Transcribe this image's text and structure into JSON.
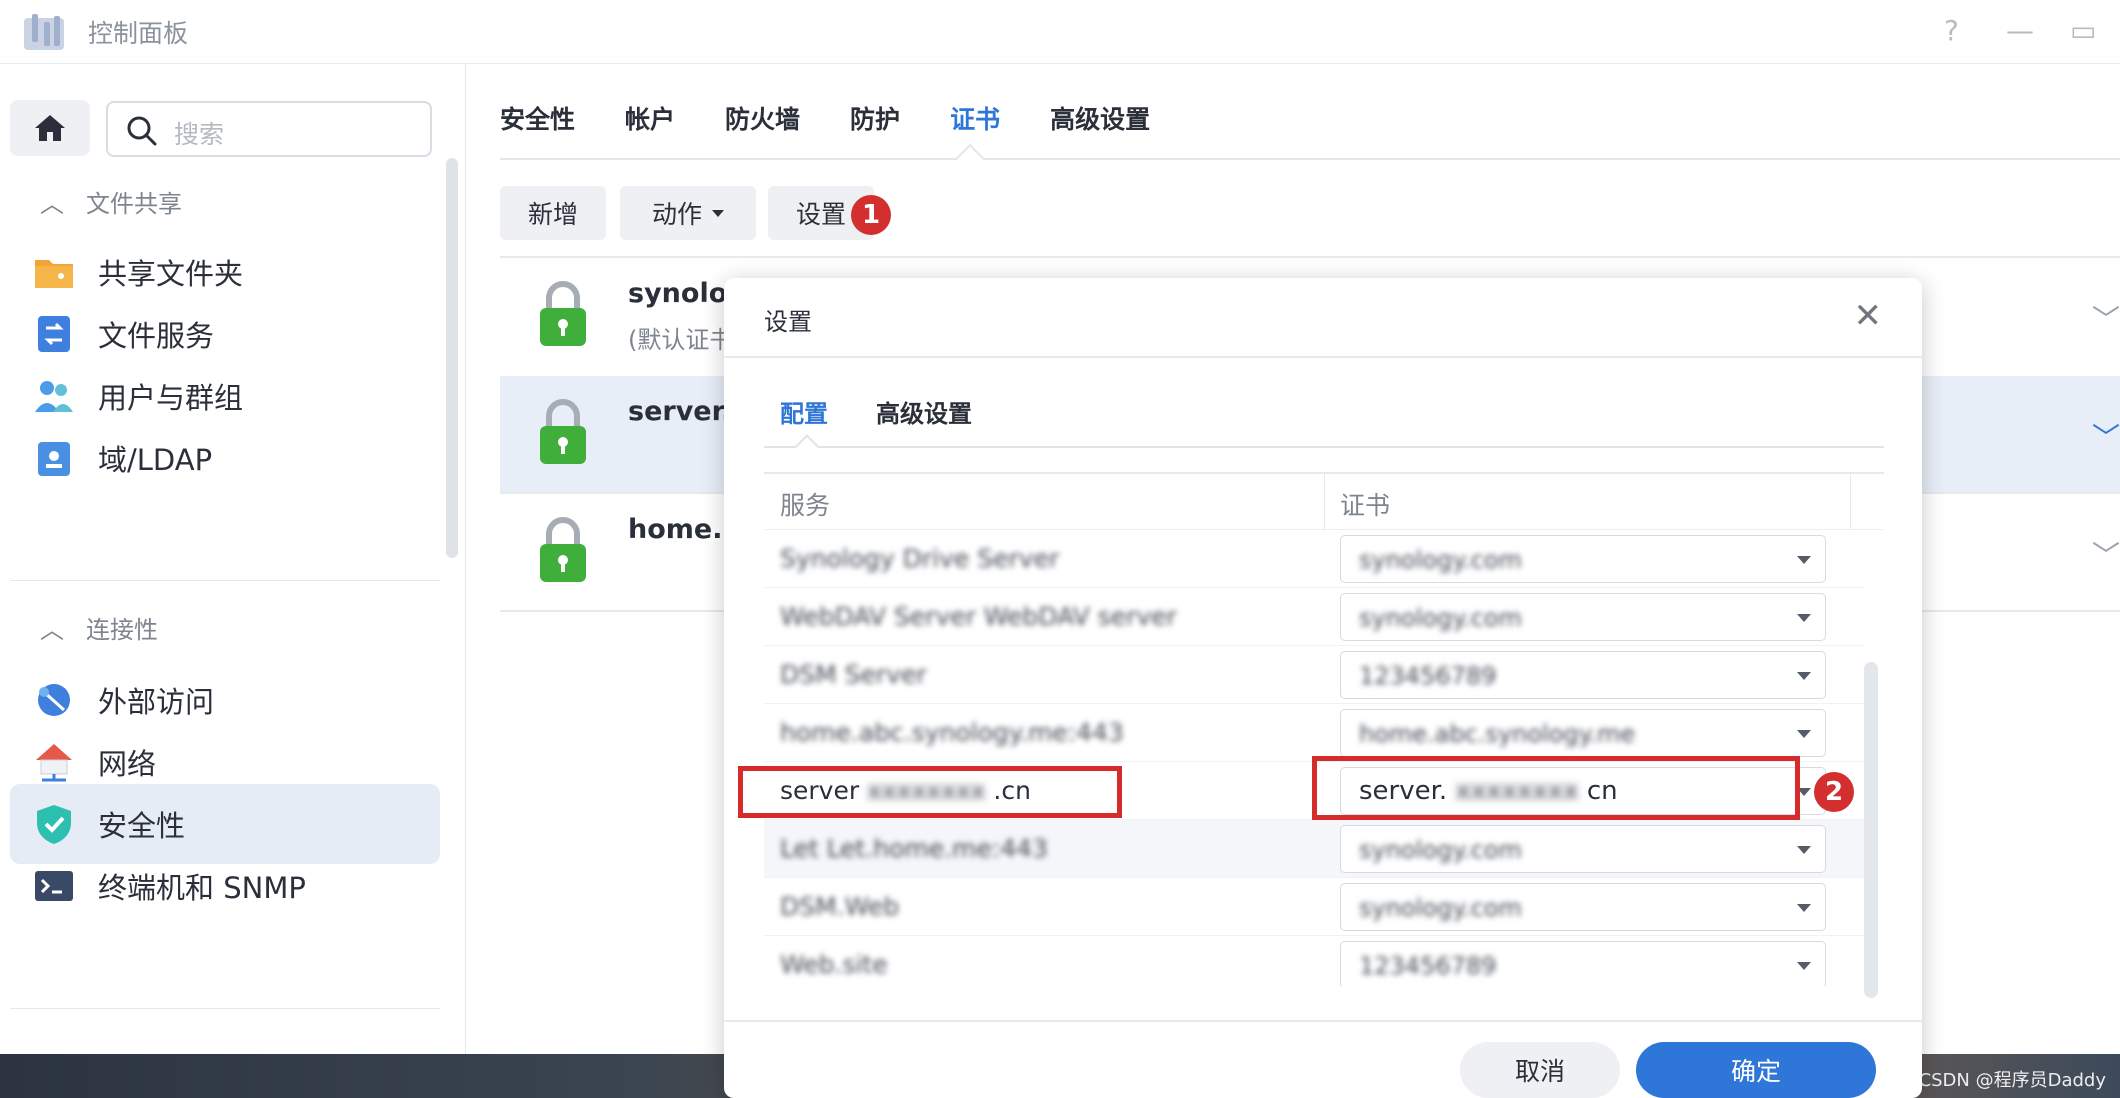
{
  "window": {
    "title": "控制面板",
    "help": "?",
    "minimize": "—",
    "maximize": "▭"
  },
  "sidebar": {
    "search_placeholder": "搜索",
    "section_file_sharing": "文件共享",
    "section_connectivity": "连接性",
    "items": [
      {
        "label": "共享文件夹"
      },
      {
        "label": "文件服务"
      },
      {
        "label": "用户与群组"
      },
      {
        "label": "域/LDAP"
      },
      {
        "label": "外部访问"
      },
      {
        "label": "网络"
      },
      {
        "label": "安全性"
      },
      {
        "label": "终端机和 SNMP"
      }
    ]
  },
  "main": {
    "tabs": [
      "安全性",
      "帐户",
      "防火墙",
      "防护",
      "证书",
      "高级设置"
    ],
    "active_tab": "证书",
    "toolbar": {
      "add": "新增",
      "action": "动作",
      "settings": "设置"
    },
    "certificates": [
      {
        "name": "synolo",
        "sub": "(默认证书"
      },
      {
        "name": "server.",
        "sub": ""
      },
      {
        "name": "home.l",
        "sub": ""
      }
    ]
  },
  "dialog": {
    "title": "设置",
    "close": "✕",
    "tabs": [
      "配置",
      "高级设置"
    ],
    "active_tab": "配置",
    "columns": {
      "service": "服务",
      "certificate": "证书"
    },
    "rows": [
      {
        "service": "Synology Drive Server",
        "cert": "synology.com"
      },
      {
        "service": "WebDAV Server WebDAV server",
        "cert": "synology.com"
      },
      {
        "service": "DSM Server",
        "cert": "123456789"
      },
      {
        "service": "home.abc.synology.me:443",
        "cert": "home.abc.synology.me"
      },
      {
        "service_prefix": "server",
        "service_blur": "xxxxxxxx",
        "service_suffix": ".cn",
        "cert_prefix": "server.",
        "cert_blur": "xxxxxxxx",
        "cert_suffix": "cn"
      },
      {
        "service": "Let Let.home.me:443",
        "cert": "synology.com"
      },
      {
        "service": "DSM.Web",
        "cert": "synology.com"
      },
      {
        "service": "Web.site",
        "cert": "123456789"
      }
    ],
    "cancel": "取消",
    "ok": "确定"
  },
  "annotations": {
    "badge1": "1",
    "badge2": "2"
  },
  "watermark": "CSDN @程序员Daddy",
  "colors": {
    "accent": "#2f76d9",
    "red": "#d52b2b",
    "green": "#3fae3a"
  }
}
